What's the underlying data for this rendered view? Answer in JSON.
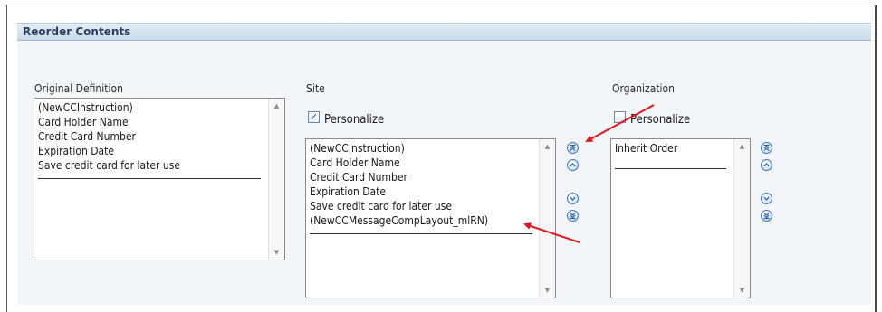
{
  "header": {
    "title": "Reorder Contents"
  },
  "original": {
    "label": "Original Definition",
    "items": [
      "(NewCCInstruction)",
      "Card Holder Name",
      "Credit Card Number",
      "Expiration Date",
      "Save credit card for later use"
    ]
  },
  "site": {
    "label": "Site",
    "personalize_label": "Personalize",
    "personalize_checked": true,
    "items": [
      "(NewCCInstruction)",
      "Card Holder Name",
      "Credit Card Number",
      "Expiration Date",
      "Save credit card for later use",
      "(NewCCMessageCompLayout_mlRN)"
    ]
  },
  "organization": {
    "label": "Organization",
    "personalize_label": "Personalize",
    "personalize_checked": false,
    "items": [
      "Inherit Order"
    ]
  },
  "icons": {
    "move_top": "move-to-top-icon",
    "move_up": "move-up-icon",
    "move_down": "move-down-icon",
    "move_bottom": "move-to-bottom-icon"
  },
  "colors": {
    "header_text": "#2f3f5f",
    "annotation_arrow": "#e8141c",
    "button_blue": "#3d78c0"
  }
}
